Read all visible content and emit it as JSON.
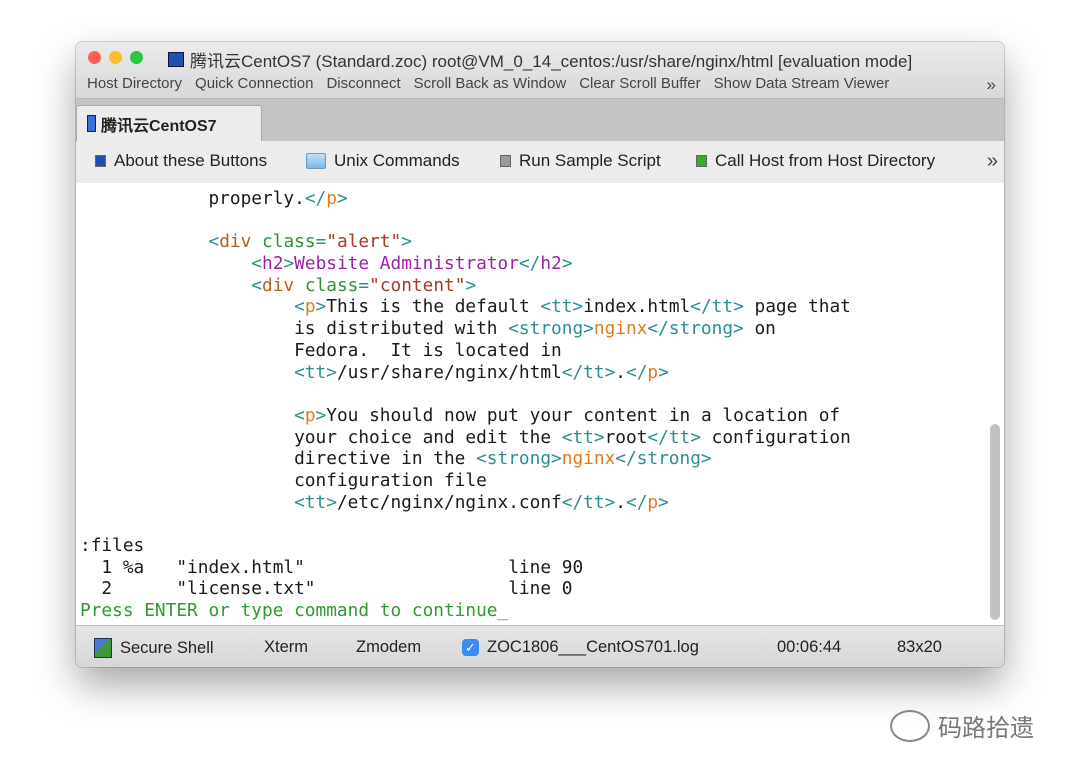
{
  "window": {
    "title": "腾讯云CentOS7 (Standard.zoc) root@VM_0_14_centos:/usr/share/nginx/html [evaluation mode]",
    "menu": [
      "Host Directory",
      "Quick Connection",
      "Disconnect",
      "Scroll Back as Window",
      "Clear Scroll Buffer",
      "Show Data Stream Viewer"
    ],
    "menu_more": "»"
  },
  "tab": {
    "label": "腾讯云CentOS7"
  },
  "buttons": {
    "items": [
      {
        "label": "About these Buttons",
        "icon": "blue-square-icon",
        "color": "#1e4fb0"
      },
      {
        "label": "Unix Commands",
        "icon": "folder-icon",
        "color": "#8fc4ee"
      },
      {
        "label": "Run Sample Script",
        "icon": "gray-square-icon",
        "color": "#9a9a9a"
      },
      {
        "label": "Call Host from Host Directory",
        "icon": "green-square-icon",
        "color": "#2fae2f"
      }
    ],
    "more": "»"
  },
  "terminal": {
    "lines": [
      [
        [
          "n",
          "            properly."
        ],
        [
          "b",
          "</"
        ],
        [
          "o",
          "p"
        ],
        [
          "b",
          ">"
        ]
      ],
      [],
      [
        [
          "n",
          "            "
        ],
        [
          "b",
          "<"
        ],
        [
          "t",
          "div"
        ],
        [
          "n",
          " "
        ],
        [
          "a",
          "class"
        ],
        [
          "b",
          "="
        ],
        [
          "s",
          "\"alert\""
        ],
        [
          "b",
          ">"
        ]
      ],
      [
        [
          "n",
          "                "
        ],
        [
          "b",
          "<"
        ],
        [
          "h",
          "h2"
        ],
        [
          "b",
          ">"
        ],
        [
          "h",
          "Website Administrator"
        ],
        [
          "b",
          "</"
        ],
        [
          "h",
          "h2"
        ],
        [
          "b",
          ">"
        ]
      ],
      [
        [
          "n",
          "                "
        ],
        [
          "b",
          "<"
        ],
        [
          "t",
          "div"
        ],
        [
          "n",
          " "
        ],
        [
          "a",
          "class"
        ],
        [
          "b",
          "="
        ],
        [
          "s",
          "\"content\""
        ],
        [
          "b",
          ">"
        ]
      ],
      [
        [
          "n",
          "                    "
        ],
        [
          "b",
          "<"
        ],
        [
          "o",
          "p"
        ],
        [
          "b",
          ">"
        ],
        [
          "n",
          "This is the default "
        ],
        [
          "b",
          "<tt>"
        ],
        [
          "n",
          "index.html"
        ],
        [
          "b",
          "</tt>"
        ],
        [
          "n",
          " page that"
        ]
      ],
      [
        [
          "n",
          "                    is distributed with "
        ],
        [
          "b",
          "<strong>"
        ],
        [
          "o",
          "nginx"
        ],
        [
          "b",
          "</strong>"
        ],
        [
          "n",
          " on"
        ]
      ],
      [
        [
          "n",
          "                    Fedora.  It is located in"
        ]
      ],
      [
        [
          "n",
          "                    "
        ],
        [
          "b",
          "<tt>"
        ],
        [
          "n",
          "/usr/share/nginx/html"
        ],
        [
          "b",
          "</tt>"
        ],
        [
          "n",
          "."
        ],
        [
          "b",
          "</"
        ],
        [
          "o",
          "p"
        ],
        [
          "b",
          ">"
        ]
      ],
      [],
      [
        [
          "n",
          "                    "
        ],
        [
          "b",
          "<"
        ],
        [
          "o",
          "p"
        ],
        [
          "b",
          ">"
        ],
        [
          "n",
          "You should now put your content in a location of"
        ]
      ],
      [
        [
          "n",
          "                    your choice and edit the "
        ],
        [
          "b",
          "<tt>"
        ],
        [
          "n",
          "root"
        ],
        [
          "b",
          "</tt>"
        ],
        [
          "n",
          " configuration"
        ]
      ],
      [
        [
          "n",
          "                    directive in the "
        ],
        [
          "b",
          "<strong>"
        ],
        [
          "o",
          "nginx"
        ],
        [
          "b",
          "</strong>"
        ]
      ],
      [
        [
          "n",
          "                    configuration file"
        ]
      ],
      [
        [
          "n",
          "                    "
        ],
        [
          "b",
          "<tt>"
        ],
        [
          "n",
          "/etc/nginx/nginx.conf"
        ],
        [
          "b",
          "</tt>"
        ],
        [
          "n",
          "."
        ],
        [
          "b",
          "</"
        ],
        [
          "o",
          "p"
        ],
        [
          "b",
          ">"
        ]
      ],
      [],
      [
        [
          "n",
          ":files"
        ]
      ],
      [
        [
          "n",
          "  1 %a   \"index.html\"                   line 90"
        ]
      ],
      [
        [
          "n",
          "  2      \"license.txt\"                  line 0"
        ]
      ],
      [
        [
          "g",
          "Press ENTER or type command to continue_"
        ]
      ]
    ],
    "scroll_position": 0.55
  },
  "statusbar": {
    "protocol": "Secure Shell",
    "emulation": "Xterm",
    "transfer": "Zmodem",
    "logging_enabled": true,
    "log_file": "ZOC1806___CentOS701.log",
    "elapsed": "00:06:44",
    "size": "83x20"
  },
  "watermark": "码路拾遗",
  "colors": {
    "tag": "#2b8f8f",
    "attr": "#2f8f3a",
    "string": "#a33b2a",
    "heading": "#a020a8",
    "strong": "#e07b1a",
    "prompt": "#2f9a2f"
  }
}
